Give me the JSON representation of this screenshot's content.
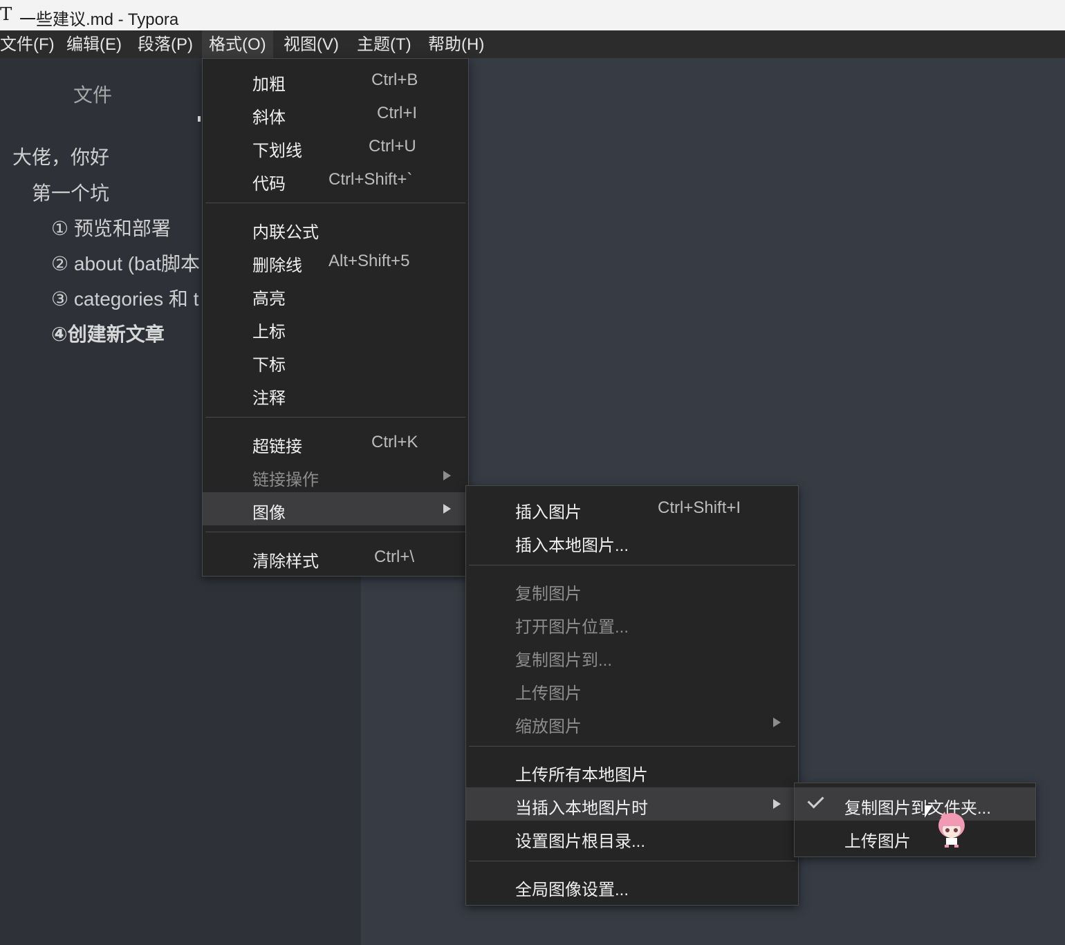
{
  "window": {
    "app_icon": "T",
    "title": "一些建议.md - Typora"
  },
  "menubar": {
    "file": "文件(F)",
    "edit": "编辑(E)",
    "paragraph": "段落(P)",
    "format": "格式(O)",
    "view": "视图(V)",
    "theme": "主题(T)",
    "help": "帮助(H)"
  },
  "sidebar": {
    "files_tab": "文件",
    "outline": [
      "大佬，你好",
      "第一个坑",
      "① 预览和部署",
      "② about (bat脚本",
      "③ categories 和 t",
      "④创建新文章"
    ]
  },
  "format_menu": {
    "bold": {
      "label": "加粗",
      "shortcut": "Ctrl+B"
    },
    "italic": {
      "label": "斜体",
      "shortcut": "Ctrl+I"
    },
    "underline": {
      "label": "下划线",
      "shortcut": "Ctrl+U"
    },
    "code": {
      "label": "代码",
      "shortcut": "Ctrl+Shift+`"
    },
    "inline_math": {
      "label": "内联公式"
    },
    "strikethrough": {
      "label": "删除线",
      "shortcut": "Alt+Shift+5"
    },
    "highlight": {
      "label": "高亮"
    },
    "superscript": {
      "label": "上标"
    },
    "subscript": {
      "label": "下标"
    },
    "comment": {
      "label": "注释"
    },
    "hyperlink": {
      "label": "超链接",
      "shortcut": "Ctrl+K"
    },
    "link_ops": {
      "label": "链接操作"
    },
    "image": {
      "label": "图像"
    },
    "clear_style": {
      "label": "清除样式",
      "shortcut": "Ctrl+\\"
    }
  },
  "image_menu": {
    "insert_image": {
      "label": "插入图片",
      "shortcut": "Ctrl+Shift+I"
    },
    "insert_local": {
      "label": "插入本地图片..."
    },
    "copy_image": {
      "label": "复制图片"
    },
    "open_location": {
      "label": "打开图片位置..."
    },
    "copy_to": {
      "label": "复制图片到..."
    },
    "upload": {
      "label": "上传图片"
    },
    "zoom": {
      "label": "缩放图片"
    },
    "upload_all": {
      "label": "上传所有本地图片"
    },
    "when_insert": {
      "label": "当插入本地图片时"
    },
    "set_root": {
      "label": "设置图片根目录..."
    },
    "global_settings": {
      "label": "全局图像设置..."
    }
  },
  "insert_local_menu": {
    "copy_to_folder": {
      "label": "复制图片到文件夹...",
      "checked": true
    },
    "upload": {
      "label": "上传图片"
    }
  }
}
